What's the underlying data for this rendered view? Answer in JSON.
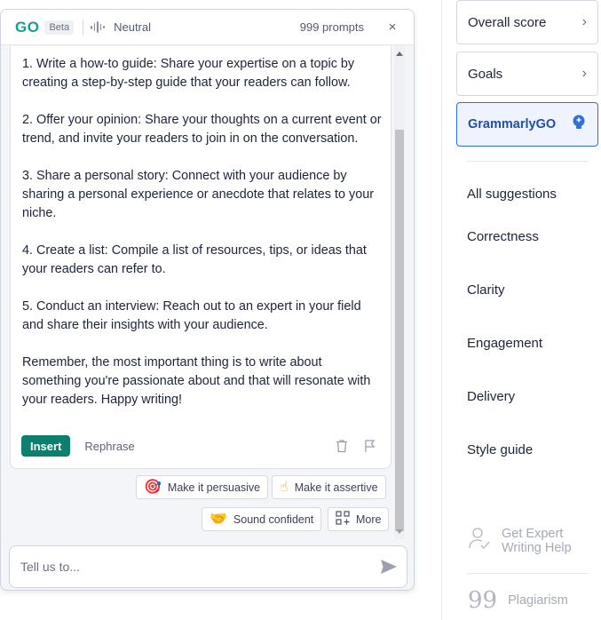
{
  "header": {
    "logo": "GO",
    "badge": "Beta",
    "tone": "Neutral",
    "prompts": "999 prompts",
    "close": "×"
  },
  "response": {
    "paragraphs": [
      "1. Write a how-to guide: Share your expertise on a topic by creating a step-by-step guide that your readers can follow.",
      "2. Offer your opinion: Share your thoughts on a current event or trend, and invite your readers to join in on the conversation.",
      "3. Share a personal story: Connect with your audience by sharing a personal experience or anecdote that relates to your niche.",
      "4. Create a list: Compile a list of resources, tips, or ideas that your readers can refer to.",
      "5. Conduct an interview: Reach out to an expert in your field and share their insights with your audience.",
      "Remember, the most important thing is to write about something you're passionate about and that will resonate with your readers. Happy writing!"
    ],
    "insert_label": "Insert",
    "rephrase_label": "Rephrase"
  },
  "chips": [
    {
      "label": "Make it persuasive",
      "icon": "target-icon",
      "glyph": "🎯"
    },
    {
      "label": "Make it assertive",
      "icon": "pointing-hand-icon",
      "glyph": "☝"
    },
    {
      "label": "Sound confident",
      "icon": "handshake-icon",
      "glyph": "🤝"
    },
    {
      "label": "More",
      "icon": "grid-plus-icon"
    }
  ],
  "input": {
    "placeholder": "Tell us to..."
  },
  "sidebar": {
    "overall_score": "Overall score",
    "goals": "Goals",
    "grammarlygo": "GrammarlyGO",
    "items": [
      "All suggestions",
      "Correctness",
      "Clarity",
      "Engagement",
      "Delivery",
      "Style guide"
    ],
    "expert_help": "Get Expert Writing Help",
    "plagiarism": "Plagiarism"
  },
  "colors": {
    "brand_green": "#15a08a",
    "insert_green": "#0d7f6e",
    "active_blue": "#2f6fd8"
  }
}
